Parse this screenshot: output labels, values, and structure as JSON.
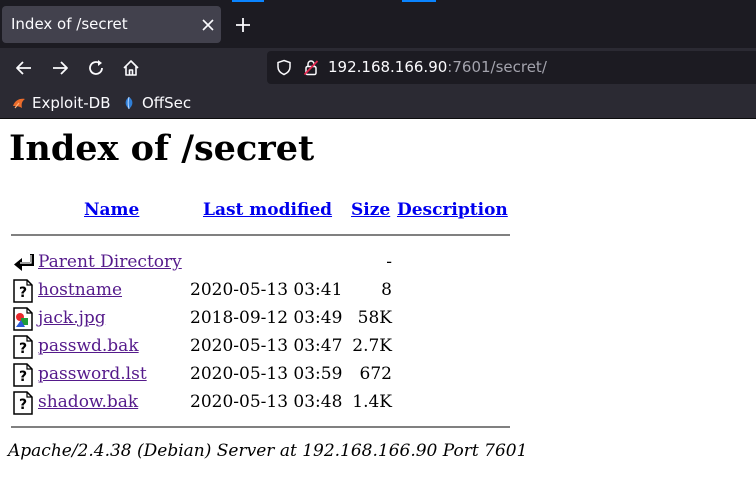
{
  "browser": {
    "tab": {
      "title": "Index of /secret"
    },
    "url": {
      "host": "192.168.166.90",
      "rest": ":7601/secret/"
    },
    "bookmarks": [
      {
        "label": "Exploit-DB",
        "icon": "exploit-db-icon"
      },
      {
        "label": "OffSec",
        "icon": "offsec-icon"
      }
    ],
    "accent_color": "#0a84ff"
  },
  "page": {
    "title": "Index of /secret",
    "columns": {
      "name": "Name",
      "last_modified": "Last modified",
      "size": "Size",
      "description": "Description"
    },
    "rows": [
      {
        "name": "Parent Directory",
        "modified": "",
        "size": "-",
        "icon": "back-arrow-icon"
      },
      {
        "name": "hostname",
        "modified": "2020-05-13 03:41",
        "size": "8",
        "icon": "unknown-file-icon"
      },
      {
        "name": "jack.jpg",
        "modified": "2018-09-12 03:49",
        "size": "58K",
        "icon": "image-file-icon"
      },
      {
        "name": "passwd.bak",
        "modified": "2020-05-13 03:47",
        "size": "2.7K",
        "icon": "unknown-file-icon"
      },
      {
        "name": "password.lst",
        "modified": "2020-05-13 03:59",
        "size": "672",
        "icon": "unknown-file-icon"
      },
      {
        "name": "shadow.bak",
        "modified": "2020-05-13 03:48",
        "size": "1.4K",
        "icon": "unknown-file-icon"
      }
    ],
    "footer": "Apache/2.4.38 (Debian) Server at 192.168.166.90 Port 7601",
    "colors": {
      "link": "#0000ee",
      "visited_link": "#551a8b"
    }
  }
}
